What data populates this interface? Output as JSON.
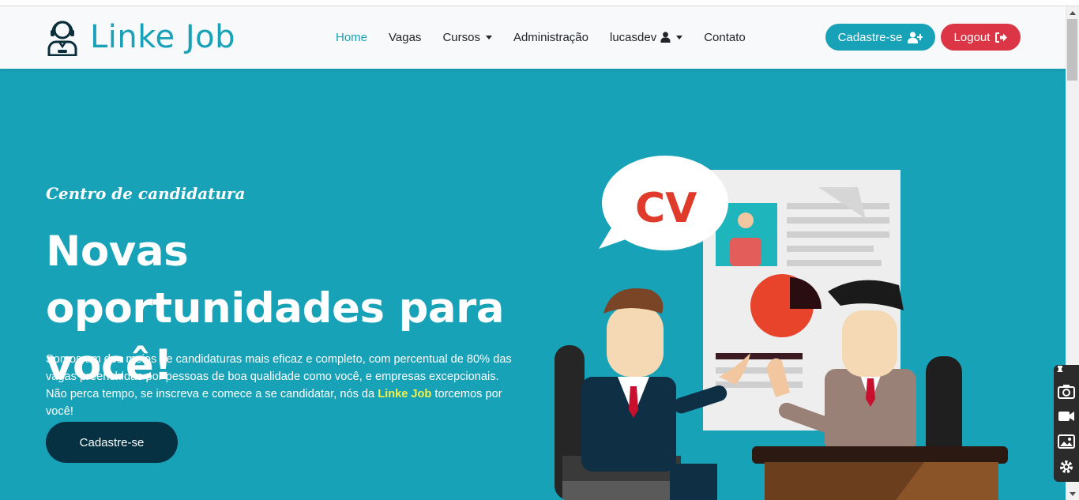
{
  "brand": {
    "name": "Linke Job"
  },
  "nav": {
    "items": [
      {
        "label": "Home",
        "active": true
      },
      {
        "label": "Vagas"
      },
      {
        "label": "Cursos",
        "dropdown": true
      },
      {
        "label": "Administração"
      },
      {
        "label": "lucasdev",
        "dropdown": true,
        "icon": "user-icon"
      },
      {
        "label": "Contato"
      }
    ],
    "signup_label": "Cadastre-se",
    "logout_label": "Logout"
  },
  "hero": {
    "eyebrow": "Centro de candidatura",
    "headline": "Novas oportunidades para você!",
    "lead_before": "Somos um dos meios de candidaturas mais eficaz e completo, com percentual de 80% das vagas preenchidas por pessoas de boa qualidade como você, e empresas excepcionais. Não perca tempo, se inscreva e comece a se candidatar, nós da ",
    "lead_highlight": "Linke Job",
    "lead_after": " torcemos por você!",
    "cta_label": "Cadastre-se",
    "illustration_text": "CV"
  },
  "colors": {
    "primary": "#17a2b8",
    "danger": "#dc3545",
    "dark_button": "#053142",
    "highlight": "#f1f14a"
  },
  "side_tools": [
    "camera-icon",
    "video-icon",
    "gallery-icon",
    "settings-icon"
  ]
}
